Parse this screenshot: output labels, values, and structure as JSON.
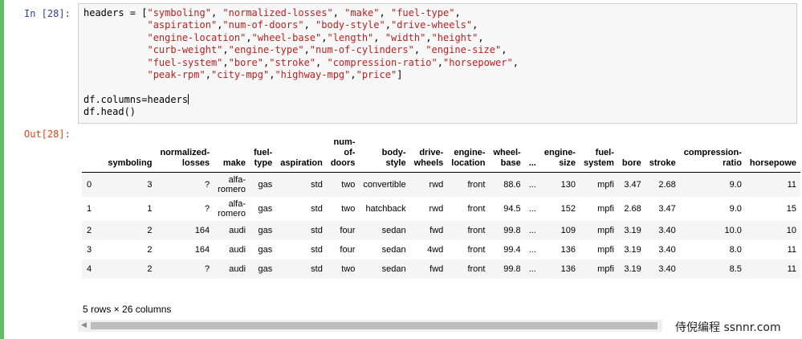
{
  "input_prompt": "In [28]:",
  "output_prompt": "Out[28]:",
  "code": {
    "lines": [
      [
        {
          "t": "headers = ["
        },
        {
          "s": "\"symboling\""
        },
        {
          "t": ", "
        },
        {
          "s": "\"normalized-losses\""
        },
        {
          "t": ", "
        },
        {
          "s": "\"make\""
        },
        {
          "t": ", "
        },
        {
          "s": "\"fuel-type\""
        },
        {
          "t": ","
        }
      ],
      [
        {
          "t": "           "
        },
        {
          "s": "\"aspiration\""
        },
        {
          "t": ","
        },
        {
          "s": "\"num-of-doors\""
        },
        {
          "t": ", "
        },
        {
          "s": "\"body-style\""
        },
        {
          "t": ","
        },
        {
          "s": "\"drive-wheels\""
        },
        {
          "t": ","
        }
      ],
      [
        {
          "t": "           "
        },
        {
          "s": "\"engine-location\""
        },
        {
          "t": ","
        },
        {
          "s": "\"wheel-base\""
        },
        {
          "t": ","
        },
        {
          "s": "\"length\""
        },
        {
          "t": ", "
        },
        {
          "s": "\"width\""
        },
        {
          "t": ","
        },
        {
          "s": "\"height\""
        },
        {
          "t": ","
        }
      ],
      [
        {
          "t": "           "
        },
        {
          "s": "\"curb-weight\""
        },
        {
          "t": ","
        },
        {
          "s": "\"engine-type\""
        },
        {
          "t": ","
        },
        {
          "s": "\"num-of-cylinders\""
        },
        {
          "t": ", "
        },
        {
          "s": "\"engine-size\""
        },
        {
          "t": ","
        }
      ],
      [
        {
          "t": "           "
        },
        {
          "s": "\"fuel-system\""
        },
        {
          "t": ","
        },
        {
          "s": "\"bore\""
        },
        {
          "t": ","
        },
        {
          "s": "\"stroke\""
        },
        {
          "t": ", "
        },
        {
          "s": "\"compression-ratio\""
        },
        {
          "t": ","
        },
        {
          "s": "\"horsepower\""
        },
        {
          "t": ","
        }
      ],
      [
        {
          "t": "           "
        },
        {
          "s": "\"peak-rpm\""
        },
        {
          "t": ","
        },
        {
          "s": "\"city-mpg\""
        },
        {
          "t": ","
        },
        {
          "s": "\"highway-mpg\""
        },
        {
          "t": ","
        },
        {
          "s": "\"price\""
        },
        {
          "t": "]"
        }
      ],
      [],
      [
        {
          "t": "df.columns=headers"
        },
        {
          "cursor": true
        }
      ],
      [
        {
          "t": "df.head()"
        }
      ]
    ]
  },
  "table": {
    "columns": [
      "",
      "symboling",
      "normalized-\nlosses",
      "make",
      "fuel-\ntype",
      "aspiration",
      "num-\nof-\ndoors",
      "body-\nstyle",
      "drive-\nwheels",
      "engine-\nlocation",
      "wheel-\nbase",
      "...",
      "engine-\nsize",
      "fuel-\nsystem",
      "bore",
      "stroke",
      "compression-\nratio",
      "horsepowe"
    ],
    "rows": [
      [
        "0",
        "3",
        "?",
        "alfa-\nromero",
        "gas",
        "std",
        "two",
        "convertible",
        "rwd",
        "front",
        "88.6",
        "...",
        "130",
        "mpfi",
        "3.47",
        "2.68",
        "9.0",
        "11"
      ],
      [
        "1",
        "1",
        "?",
        "alfa-\nromero",
        "gas",
        "std",
        "two",
        "hatchback",
        "rwd",
        "front",
        "94.5",
        "...",
        "152",
        "mpfi",
        "2.68",
        "3.47",
        "9.0",
        "15"
      ],
      [
        "2",
        "2",
        "164",
        "audi",
        "gas",
        "std",
        "four",
        "sedan",
        "fwd",
        "front",
        "99.8",
        "...",
        "109",
        "mpfi",
        "3.19",
        "3.40",
        "10.0",
        "10"
      ],
      [
        "3",
        "2",
        "164",
        "audi",
        "gas",
        "std",
        "four",
        "sedan",
        "4wd",
        "front",
        "99.4",
        "...",
        "136",
        "mpfi",
        "3.19",
        "3.40",
        "8.0",
        "11"
      ],
      [
        "4",
        "2",
        "?",
        "audi",
        "gas",
        "std",
        "two",
        "sedan",
        "fwd",
        "front",
        "99.8",
        "...",
        "136",
        "mpfi",
        "3.19",
        "3.40",
        "8.5",
        "11"
      ]
    ]
  },
  "rows_info": "5 rows × 26 columns",
  "scrollbar": {
    "left_arrow_icon": "chevron-left-icon",
    "left_arrow_glyph": "◀"
  },
  "watermark": "侍倪编程 ssnnr.com",
  "colors": {
    "active_cell_bar": "#66bb6a",
    "in_prompt": "#303f9f",
    "out_prompt": "#d84315",
    "string": "#ba2121"
  }
}
